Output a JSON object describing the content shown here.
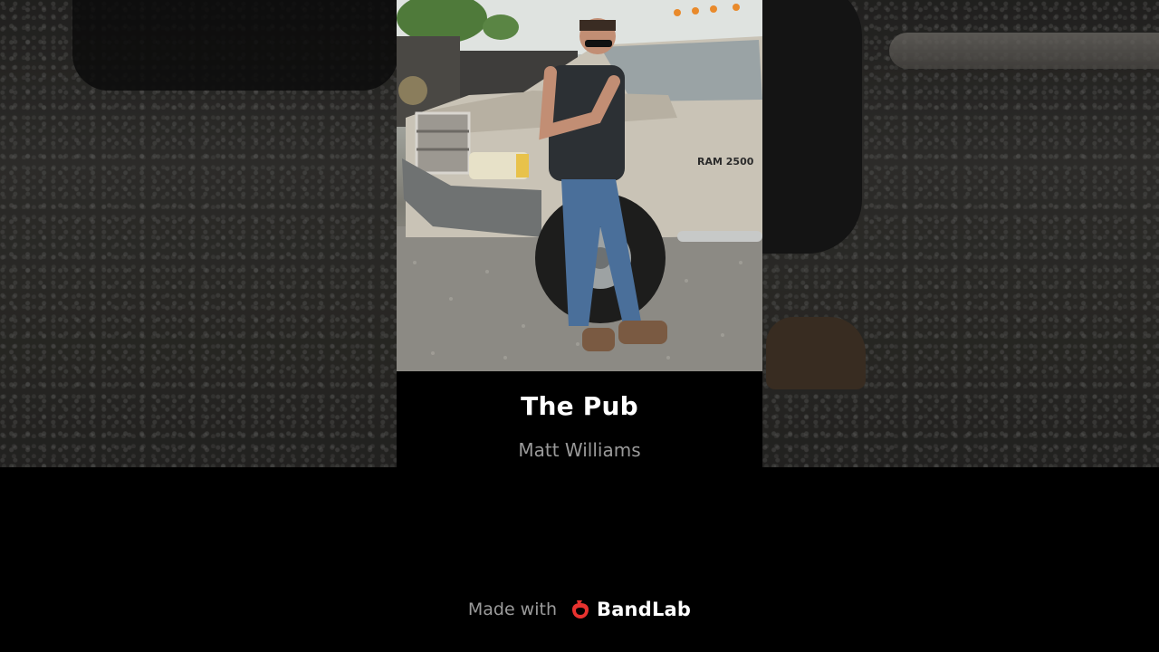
{
  "track": {
    "title": "The Pub",
    "artist": "Matt Williams"
  },
  "cover_art": {
    "badge_text": "RAM 2500"
  },
  "footer": {
    "made_with_label": "Made with",
    "brand_name": "BandLab",
    "brand_icon": "bandlab-logo-icon",
    "brand_color": "#e8322f"
  },
  "colors": {
    "background": "#000000",
    "title": "#ffffff",
    "subtitle": "#9a9a9a"
  }
}
